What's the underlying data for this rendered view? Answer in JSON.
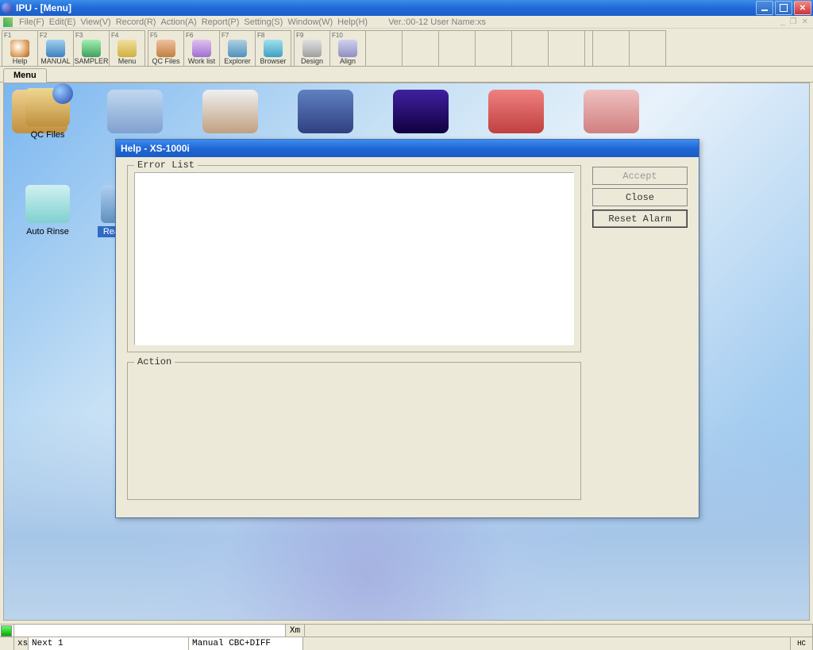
{
  "app": {
    "title": "IPU - [Menu]",
    "version_text": "Ver.:00-12 User Name:xs"
  },
  "menus": {
    "file": "File(F)",
    "edit": "Edit(E)",
    "view": "View(V)",
    "record": "Record(R)",
    "action": "Action(A)",
    "report": "Report(P)",
    "setting": "Setting(S)",
    "window": "Window(W)",
    "help": "Help(H)"
  },
  "toolbar": [
    {
      "fkey": "F1",
      "label": "Help"
    },
    {
      "fkey": "F2",
      "label": "MANUAL"
    },
    {
      "fkey": "F3",
      "label": "SAMPLER"
    },
    {
      "fkey": "F4",
      "label": "Menu"
    },
    {
      "fkey": "F5",
      "label": "QC Files"
    },
    {
      "fkey": "F6",
      "label": "Work list"
    },
    {
      "fkey": "F7",
      "label": "Explorer"
    },
    {
      "fkey": "F8",
      "label": "Browser"
    },
    {
      "fkey": "F9",
      "label": "Design"
    },
    {
      "fkey": "F10",
      "label": "Align"
    }
  ],
  "tab": {
    "menu": "Menu"
  },
  "desktop": {
    "qc_files": "QC Files",
    "auto_rinse": "Auto Rinse",
    "reag": "Reag"
  },
  "dialog": {
    "title": "Help - XS-1000i",
    "error_list_label": "Error List",
    "action_label": "Action",
    "accept": "Accept",
    "close": "Close",
    "reset_alarm": "Reset Alarm"
  },
  "status": {
    "xm": "Xm",
    "xs": "xs",
    "next": "Next 1",
    "mode": "Manual CBC+DIFF",
    "hc": "HC"
  }
}
